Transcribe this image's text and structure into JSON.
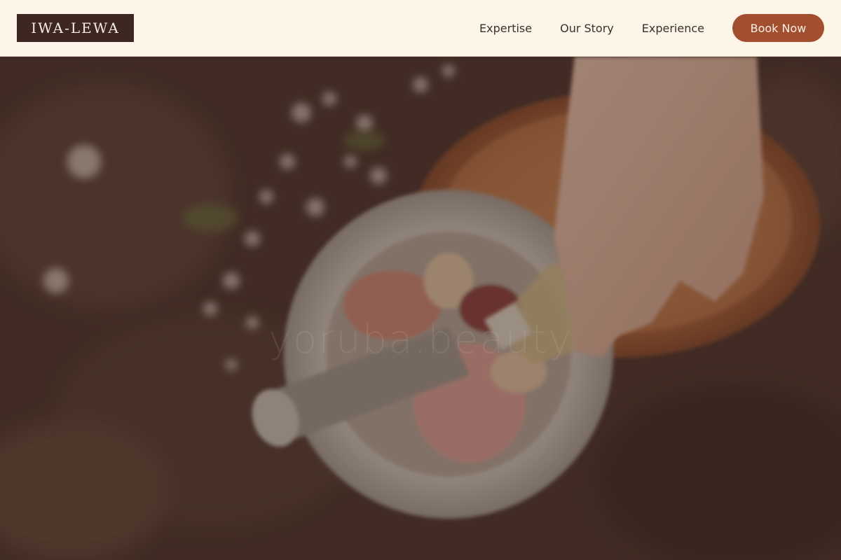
{
  "brand": {
    "logo_text": "IWA-LEWA"
  },
  "nav": {
    "links": [
      {
        "label": "Expertise"
      },
      {
        "label": "Our Story"
      },
      {
        "label": "Experience"
      }
    ],
    "cta_label": "Book Now"
  },
  "hero": {
    "watermark_text": "yoruba.beauty",
    "image_description_icon": "mortar-pestle-photo"
  },
  "colors": {
    "header_bg": "#fdf5e8",
    "logo_bg": "#3e2723",
    "cta_bg": "#a24f2f",
    "nav_text": "#3b302b"
  }
}
